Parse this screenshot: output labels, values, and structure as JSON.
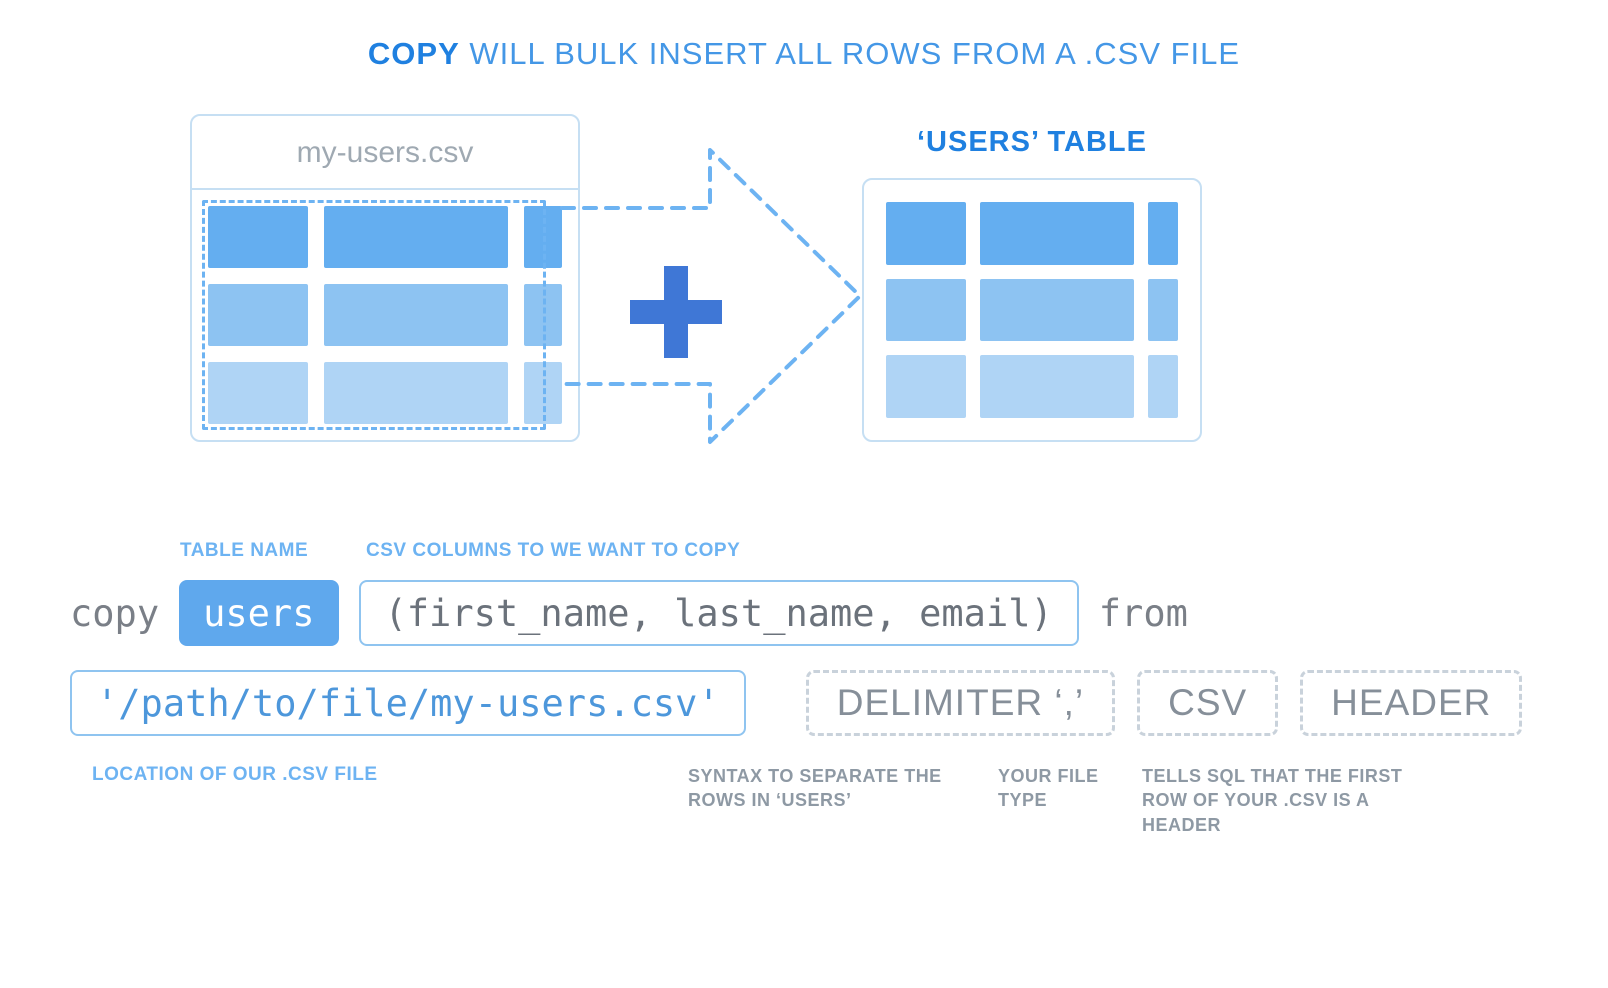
{
  "title": {
    "bold": "COPY",
    "rest": " WILL BULK INSERT ALL ROWS FROM A .CSV FILE"
  },
  "csv": {
    "filename": "my-users.csv"
  },
  "users": {
    "label": "‘USERS’ TABLE"
  },
  "captions": {
    "table_name": "TABLE NAME",
    "columns": "CSV COLUMNS TO WE WANT TO COPY",
    "path": "LOCATION OF OUR .CSV FILE",
    "delimiter": "SYNTAX TO SEPARATE THE ROWS IN ‘USERS’",
    "filetype": "YOUR FILE TYPE",
    "header": "TELLS SQL THAT THE FIRST ROW OF YOUR .CSV IS A HEADER"
  },
  "sql": {
    "copy": "copy",
    "table": "users",
    "columns": "(first_name, last_name, email)",
    "from": "from",
    "path": "'/path/to/file/my-users.csv'",
    "delimiter": "DELIMITER ‘,’",
    "csv": "CSV",
    "header": "HEADER"
  },
  "colors": {
    "rows": [
      "#64aef0",
      "#8dc3f2",
      "#afd4f5"
    ]
  }
}
